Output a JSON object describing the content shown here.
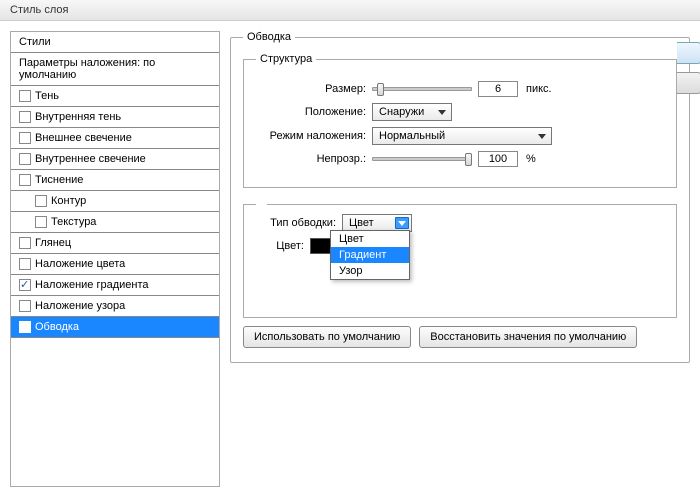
{
  "window": {
    "title": "Стиль слоя"
  },
  "styles": {
    "header": "Стили",
    "blending": "Параметры наложения: по умолчанию",
    "items": [
      {
        "label": "Тень",
        "checked": false,
        "indent": false
      },
      {
        "label": "Внутренняя тень",
        "checked": false,
        "indent": false
      },
      {
        "label": "Внешнее свечение",
        "checked": false,
        "indent": false
      },
      {
        "label": "Внутреннее свечение",
        "checked": false,
        "indent": false
      },
      {
        "label": "Тиснение",
        "checked": false,
        "indent": false
      },
      {
        "label": "Контур",
        "checked": false,
        "indent": true
      },
      {
        "label": "Текстура",
        "checked": false,
        "indent": true
      },
      {
        "label": "Глянец",
        "checked": false,
        "indent": false
      },
      {
        "label": "Наложение цвета",
        "checked": false,
        "indent": false
      },
      {
        "label": "Наложение градиента",
        "checked": true,
        "indent": false
      },
      {
        "label": "Наложение узора",
        "checked": false,
        "indent": false
      },
      {
        "label": "Обводка",
        "checked": true,
        "indent": false,
        "selected": true
      }
    ]
  },
  "stroke": {
    "group_label": "Обводка",
    "structure_label": "Структура",
    "size_label": "Размер:",
    "size_value": "6",
    "size_unit": "пикс.",
    "position_label": "Положение:",
    "position_value": "Снаружи",
    "blend_label": "Режим наложения:",
    "blend_value": "Нормальный",
    "opacity_label": "Непрозр.:",
    "opacity_value": "100",
    "opacity_unit": "%",
    "filltype_label": "Тип обводки:",
    "filltype_value": "Цвет",
    "filltype_options": [
      "Цвет",
      "Градиент",
      "Узор"
    ],
    "filltype_hover_index": 1,
    "color_label": "Цвет:",
    "color_value": "#000000"
  },
  "buttons": {
    "make_default": "Использовать по умолчанию",
    "reset_default": "Восстановить значения по умолчанию"
  }
}
